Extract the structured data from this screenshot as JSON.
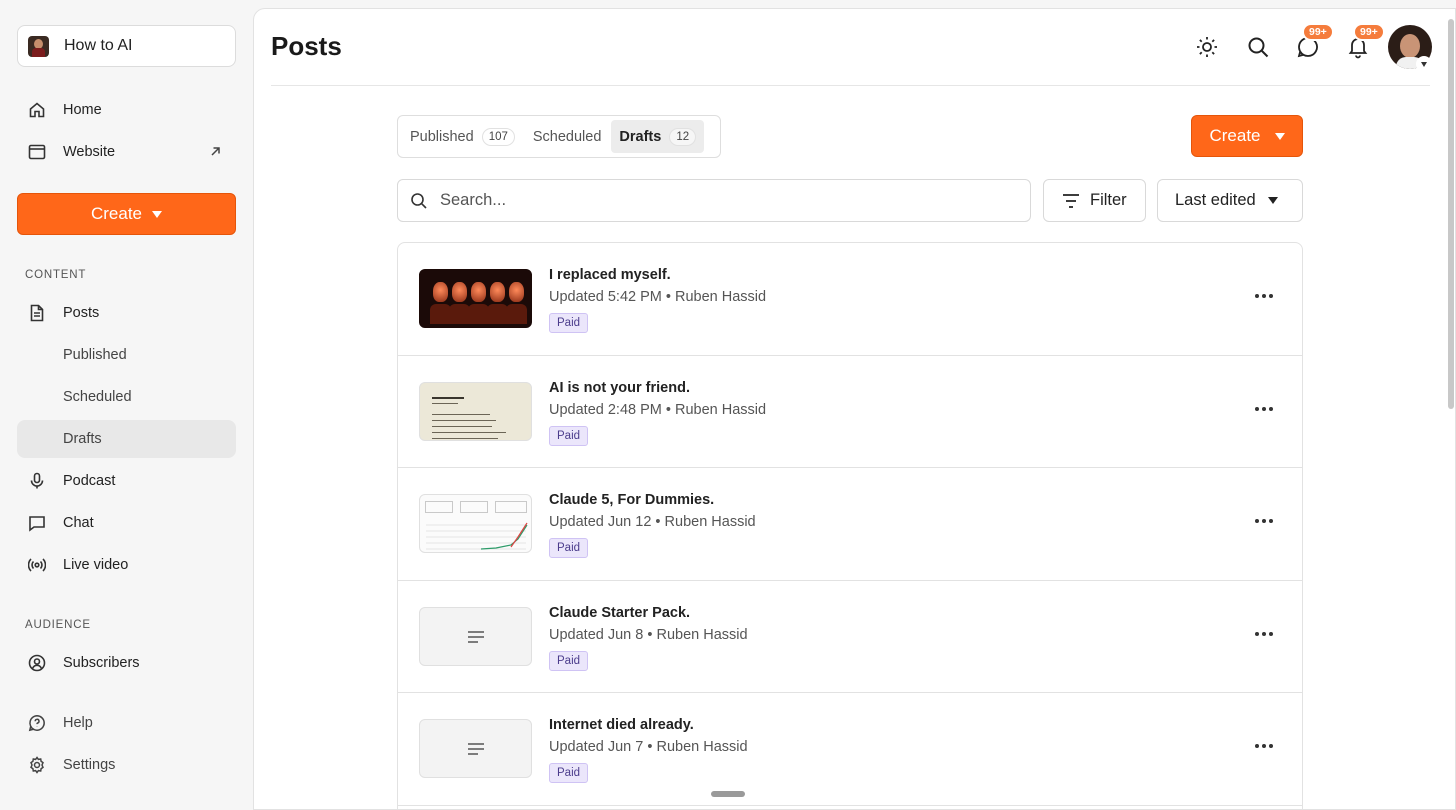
{
  "publication": {
    "name": "How to AI"
  },
  "sidebar": {
    "home": "Home",
    "website": "Website",
    "create": "Create",
    "content_label": "CONTENT",
    "posts": "Posts",
    "published": "Published",
    "scheduled": "Scheduled",
    "drafts": "Drafts",
    "podcast": "Podcast",
    "chat": "Chat",
    "live_video": "Live video",
    "audience_label": "AUDIENCE",
    "subscribers": "Subscribers",
    "help": "Help",
    "settings": "Settings"
  },
  "header": {
    "title": "Posts",
    "chat_badge": "99+",
    "notif_badge": "99+"
  },
  "tabs": [
    {
      "label": "Published",
      "count": "107"
    },
    {
      "label": "Scheduled",
      "count": ""
    },
    {
      "label": "Drafts",
      "count": "12"
    }
  ],
  "toolbar": {
    "create": "Create",
    "search_placeholder": "Search...",
    "filter": "Filter",
    "sort": "Last edited"
  },
  "posts": [
    {
      "title": "I replaced myself.",
      "updated": "Updated 5:42 PM",
      "author": "Ruben Hassid",
      "badge": "Paid"
    },
    {
      "title": "AI is not your friend.",
      "updated": "Updated 2:48 PM",
      "author": "Ruben Hassid",
      "badge": "Paid"
    },
    {
      "title": "Claude 5, For Dummies.",
      "updated": "Updated Jun 12",
      "author": "Ruben Hassid",
      "badge": "Paid"
    },
    {
      "title": "Claude Starter Pack.",
      "updated": "Updated Jun 8",
      "author": "Ruben Hassid",
      "badge": "Paid"
    },
    {
      "title": "Internet died already.",
      "updated": "Updated Jun 7",
      "author": "Ruben Hassid",
      "badge": "Paid"
    }
  ],
  "colors": {
    "accent": "#ff6719",
    "badge": "#f57c3c",
    "paid_bg": "#ebe6fb"
  },
  "icons": [
    "home-icon",
    "website-icon",
    "external-link-icon",
    "posts-icon",
    "mic-icon",
    "chat-icon",
    "live-icon",
    "subscribers-icon",
    "help-icon",
    "settings-icon",
    "sun-icon",
    "search-icon",
    "filter-icon",
    "more-icon"
  ]
}
